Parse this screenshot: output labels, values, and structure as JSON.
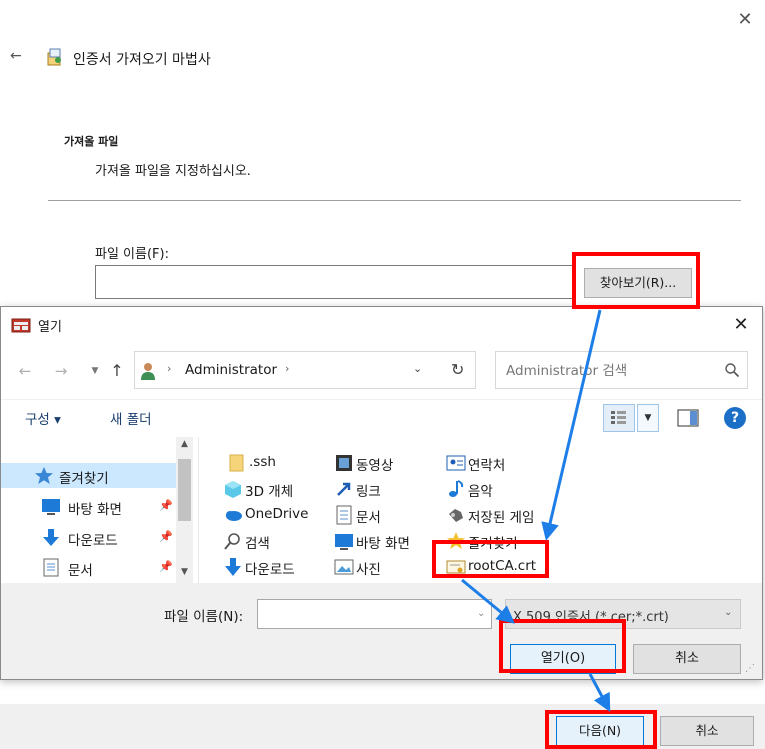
{
  "wizard": {
    "title": "인증서 가져오기 마법사",
    "section_title": "가져올 파일",
    "section_description": "가져올 파일을 지정하십시오.",
    "file_label": "파일 이름(F):",
    "file_value": "",
    "browse_button": "찾아보기(R)...",
    "next_button": "다음(N)",
    "cancel_button": "취소"
  },
  "dialog": {
    "title": "열기",
    "address": "Administrator",
    "search_placeholder": "Administrator 검색",
    "toolbar": {
      "organize": "구성 ▾",
      "new_folder": "새 폴더"
    },
    "nav_items": [
      {
        "label": "즐겨찾기",
        "icon": "star-icon",
        "selected": true
      },
      {
        "label": "바탕 화면",
        "icon": "desktop-icon",
        "pinned": true
      },
      {
        "label": "다운로드",
        "icon": "download-icon",
        "pinned": true
      },
      {
        "label": "문서",
        "icon": "document-icon",
        "pinned": true
      }
    ],
    "files": [
      {
        "label": ".ssh",
        "icon": "folder-icon"
      },
      {
        "label": "3D 개체",
        "icon": "3d-objects-icon"
      },
      {
        "label": "OneDrive",
        "icon": "cloud-icon"
      },
      {
        "label": "검색",
        "icon": "search-folder-icon"
      },
      {
        "label": "다운로드",
        "icon": "download-icon"
      },
      {
        "label": "동영상",
        "icon": "video-icon"
      },
      {
        "label": "링크",
        "icon": "link-icon"
      },
      {
        "label": "문서",
        "icon": "document-icon"
      },
      {
        "label": "바탕 화면",
        "icon": "desktop-icon"
      },
      {
        "label": "사진",
        "icon": "picture-icon"
      },
      {
        "label": "연락처",
        "icon": "contacts-icon"
      },
      {
        "label": "음악",
        "icon": "music-icon"
      },
      {
        "label": "저장된 게임",
        "icon": "saved-games-icon"
      },
      {
        "label": "즐겨찾기",
        "icon": "favorites-icon"
      },
      {
        "label": "rootCA.crt",
        "icon": "certificate-icon"
      }
    ],
    "filename_label": "파일 이름(N):",
    "filename_value": "",
    "filetype": "X.509 인증서 (*.cer;*.crt)",
    "open_button": "열기(O)",
    "cancel_button": "취소"
  },
  "colors": {
    "highlight": "#ff0000",
    "arrow": "#1e7ee8",
    "selection": "#cce8ff",
    "accent": "#0078d7"
  }
}
